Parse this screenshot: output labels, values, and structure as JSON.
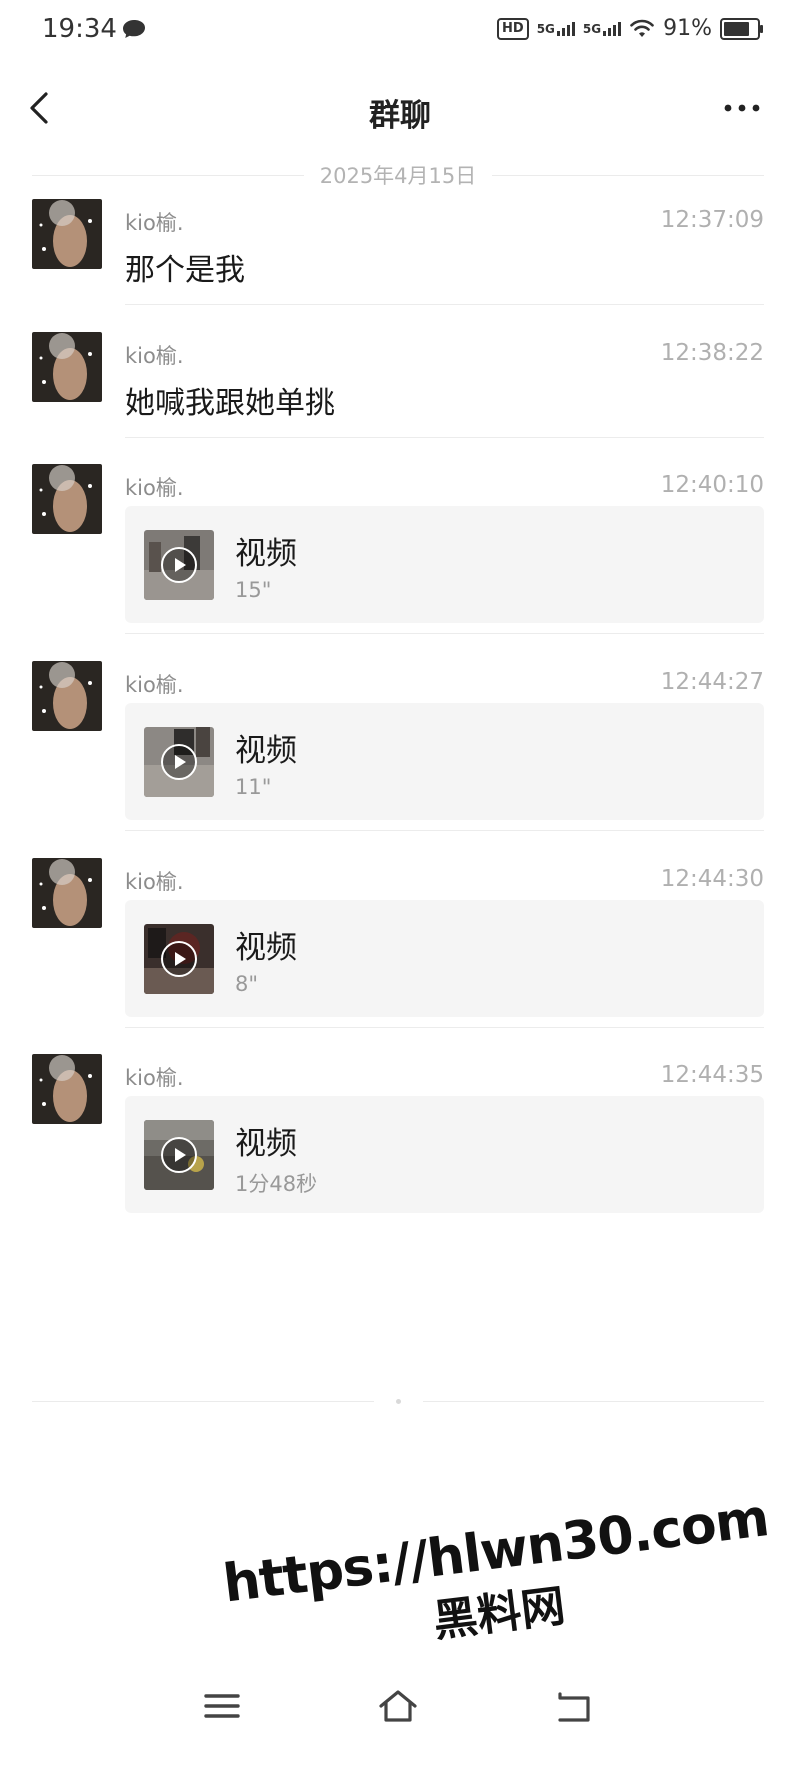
{
  "status_bar": {
    "time": "19:34",
    "hd_label": "HD",
    "net1": "5G",
    "net2": "5G",
    "battery": "91%",
    "battery_level": 0.91
  },
  "nav": {
    "title": "群聊"
  },
  "date_divider": "2025年4月15日",
  "messages": [
    {
      "sender": "kio榆.",
      "time": "12:37:09",
      "type": "text",
      "text": "那个是我"
    },
    {
      "sender": "kio榆.",
      "time": "12:38:22",
      "type": "text",
      "text": "她喊我跟她单挑"
    },
    {
      "sender": "kio榆.",
      "time": "12:40:10",
      "type": "video",
      "title": "视频",
      "duration": "15\""
    },
    {
      "sender": "kio榆.",
      "time": "12:44:27",
      "type": "video",
      "title": "视频",
      "duration": "11\""
    },
    {
      "sender": "kio榆.",
      "time": "12:44:30",
      "type": "video",
      "title": "视频",
      "duration": "8\""
    },
    {
      "sender": "kio榆.",
      "time": "12:44:35",
      "type": "video",
      "title": "视频",
      "duration": "1分48秒"
    }
  ],
  "watermark": {
    "url": "https://hlwn30.com",
    "name": "黑料网"
  },
  "icons": {
    "back": "chevron-left-icon",
    "more": "more-icon",
    "play": "play-icon",
    "menu": "menu-icon",
    "home": "home-icon",
    "return": "return-icon"
  }
}
